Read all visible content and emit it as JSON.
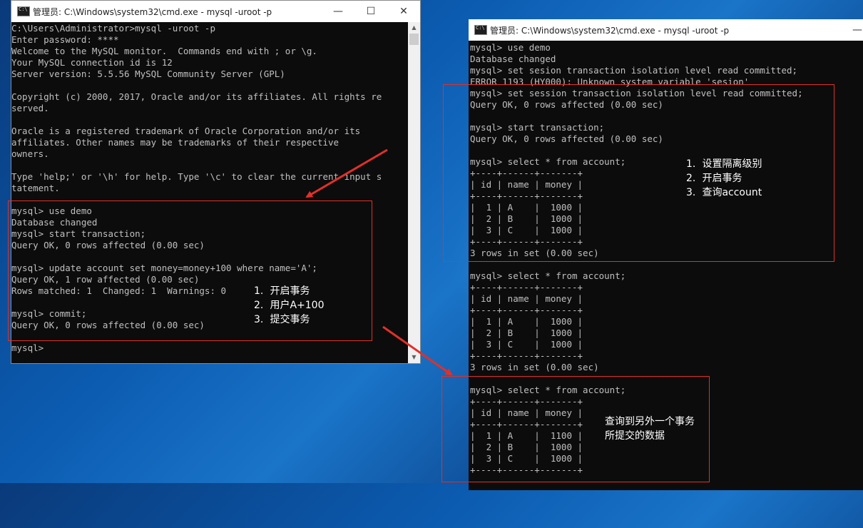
{
  "left_window": {
    "title": "管理员: C:\\Windows\\system32\\cmd.exe - mysql  -uroot -p",
    "controls": {
      "minimize": "—",
      "maximize": "☐",
      "close": "✕"
    },
    "lines": [
      "C:\\Users\\Administrator>mysql -uroot -p",
      "Enter password: ****",
      "Welcome to the MySQL monitor.  Commands end with ; or \\g.",
      "Your MySQL connection id is 12",
      "Server version: 5.5.56 MySQL Community Server (GPL)",
      "",
      "Copyright (c) 2000, 2017, Oracle and/or its affiliates. All rights re",
      "served.",
      "",
      "Oracle is a registered trademark of Oracle Corporation and/or its",
      "affiliates. Other names may be trademarks of their respective",
      "owners.",
      "",
      "Type 'help;' or '\\h' for help. Type '\\c' to clear the current input s",
      "tatement.",
      "",
      "mysql> use demo",
      "Database changed",
      "mysql> start transaction;",
      "Query OK, 0 rows affected (0.00 sec)",
      "",
      "mysql> update account set money=money+100 where name='A';",
      "Query OK, 1 row affected (0.00 sec)",
      "Rows matched: 1  Changed: 1  Warnings: 0",
      "",
      "mysql> commit;",
      "Query OK, 0 rows affected (0.00 sec)",
      "",
      "mysql>"
    ],
    "notes": [
      {
        "num": "1.",
        "text": "开启事务"
      },
      {
        "num": "2.",
        "text": "用户A+100"
      },
      {
        "num": "3.",
        "text": "提交事务"
      }
    ]
  },
  "right_window": {
    "title": "管理员: C:\\Windows\\system32\\cmd.exe - mysql  -uroot -p",
    "controls": {
      "minimize": "—"
    },
    "lines": [
      "mysql> use demo",
      "Database changed",
      "mysql> set sesion transaction isolation level read committed;",
      "ERROR 1193 (HY000): Unknown system variable 'sesion'",
      "mysql> set session transaction isolation level read committed;",
      "Query OK, 0 rows affected (0.00 sec)",
      "",
      "mysql> start transaction;",
      "Query OK, 0 rows affected (0.00 sec)",
      "",
      "mysql> select * from account;",
      "+----+------+-------+",
      "| id | name | money |",
      "+----+------+-------+",
      "|  1 | A    |  1000 |",
      "|  2 | B    |  1000 |",
      "|  3 | C    |  1000 |",
      "+----+------+-------+",
      "3 rows in set (0.00 sec)",
      "",
      "mysql> select * from account;",
      "+----+------+-------+",
      "| id | name | money |",
      "+----+------+-------+",
      "|  1 | A    |  1000 |",
      "|  2 | B    |  1000 |",
      "|  3 | C    |  1000 |",
      "+----+------+-------+",
      "3 rows in set (0.00 sec)",
      "",
      "mysql> select * from account;",
      "+----+------+-------+",
      "| id | name | money |",
      "+----+------+-------+",
      "|  1 | A    |  1100 |",
      "|  2 | B    |  1000 |",
      "|  3 | C    |  1000 |",
      "+----+------+-------+"
    ],
    "notes_top": [
      {
        "num": "1.",
        "text": "设置隔离级别"
      },
      {
        "num": "2.",
        "text": "开启事务"
      },
      {
        "num": "3.",
        "text": "查询account"
      }
    ],
    "notes_bottom": [
      "查询到另外一个事务",
      "所提交的数据"
    ]
  },
  "colors": {
    "terminal_bg": "#0c0c0c",
    "terminal_text": "#c0c0c0",
    "annotation_red": "#e0302a",
    "note_text": "#ffffff"
  }
}
